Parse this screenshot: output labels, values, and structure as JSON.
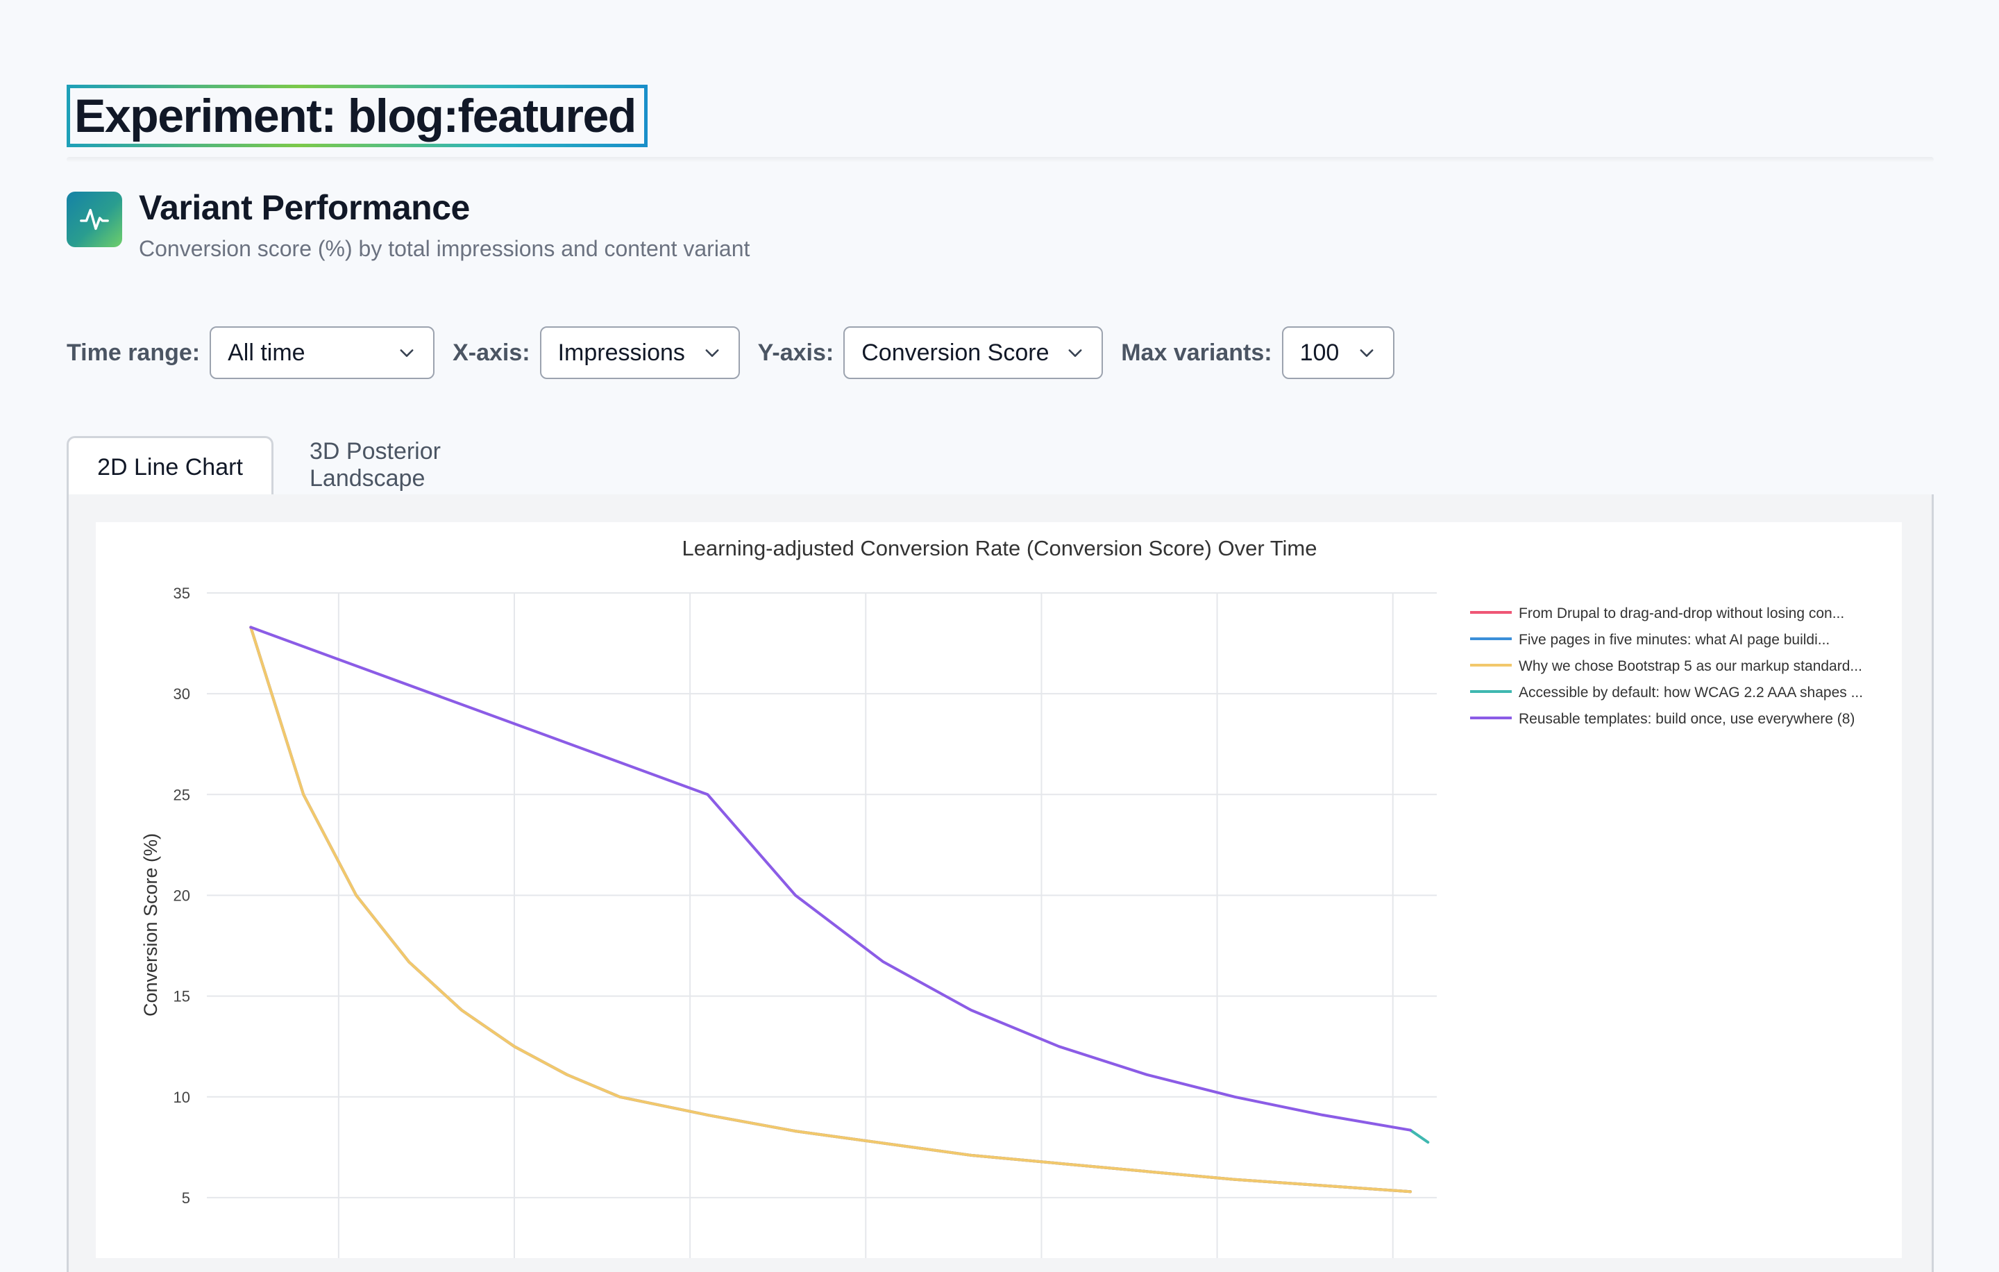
{
  "header": {
    "title": "Experiment: blog:featured"
  },
  "section": {
    "icon": "activity-pulse-icon",
    "title": "Variant Performance",
    "subtitle": "Conversion score (%) by total impressions and content variant"
  },
  "controls": {
    "time_range": {
      "label": "Time range:",
      "value": "All time"
    },
    "x_axis": {
      "label": "X-axis:",
      "value": "Impressions"
    },
    "y_axis": {
      "label": "Y-axis:",
      "value": "Conversion Score"
    },
    "max_variants": {
      "label": "Max variants:",
      "value": "100"
    }
  },
  "tabs": [
    {
      "label": "2D Line Chart",
      "active": true
    },
    {
      "label": "3D Posterior Landscape",
      "active": false
    }
  ],
  "chart_data": {
    "type": "line",
    "title": "Learning-adjusted Conversion Rate (Conversion Score) Over Time",
    "xlabel": "",
    "ylabel": "Conversion Score (%)",
    "ylim": [
      2,
      35
    ],
    "xlim": [
      -0.5,
      13.5
    ],
    "yticks": [
      5,
      10,
      15,
      20,
      25,
      30,
      35
    ],
    "grid": true,
    "legend_position": "top-right",
    "series": [
      {
        "name": "From Drupal to drag-and-drop without losing con...",
        "color": "#ef5675",
        "x": [
          0,
          0.6,
          1.2,
          1.8,
          2.4,
          3,
          3.6,
          4.2,
          5.2,
          6.2,
          7.2,
          8.2,
          9.2,
          10.2,
          11.2,
          12.2,
          13.2
        ],
        "y": [
          33.3,
          25,
          20,
          16.7,
          14.3,
          12.5,
          11.1,
          10,
          9.1,
          8.3,
          7.7,
          7.1,
          6.7,
          6.3,
          5.9,
          5.6,
          5.3
        ]
      },
      {
        "name": "Five pages in five minutes: what AI page buildi...",
        "color": "#3b8fd9",
        "x": [
          0,
          0.6,
          1.2,
          1.8,
          2.4,
          3,
          3.6,
          4.2,
          5.2,
          6.2,
          7.2,
          8.2,
          9.2,
          10.2,
          11.2,
          12.2,
          13.2
        ],
        "y": [
          33.3,
          25,
          20,
          16.7,
          14.3,
          12.5,
          11.1,
          10,
          9.1,
          8.3,
          7.7,
          7.1,
          6.7,
          6.3,
          5.9,
          5.6,
          5.3
        ]
      },
      {
        "name": "Why we chose Bootstrap 5 as our markup standard...",
        "color": "#f2c86b",
        "x": [
          0,
          0.6,
          1.2,
          1.8,
          2.4,
          3,
          3.6,
          4.2,
          5.2,
          6.2,
          7.2,
          8.2,
          9.2,
          10.2,
          11.2,
          12.2,
          13.2
        ],
        "y": [
          33.3,
          25,
          20,
          16.7,
          14.3,
          12.5,
          11.1,
          10,
          9.1,
          8.3,
          7.7,
          7.1,
          6.7,
          6.3,
          5.9,
          5.6,
          5.3
        ]
      },
      {
        "name": "Accessible by default: how WCAG 2.2 AAA shapes ...",
        "color": "#3fb8b0",
        "x": [
          13.2,
          13.4
        ],
        "y": [
          8.35,
          7.75
        ]
      },
      {
        "name": "Reusable templates: build once, use everywhere (8)",
        "color": "#8b5ce6",
        "x": [
          0,
          5.2,
          6.2,
          7.2,
          8.2,
          9.2,
          10.2,
          11.2,
          12.2,
          13.2
        ],
        "y": [
          33.3,
          25,
          20,
          16.7,
          14.3,
          12.5,
          11.1,
          10,
          9.1,
          8.35
        ]
      }
    ]
  }
}
